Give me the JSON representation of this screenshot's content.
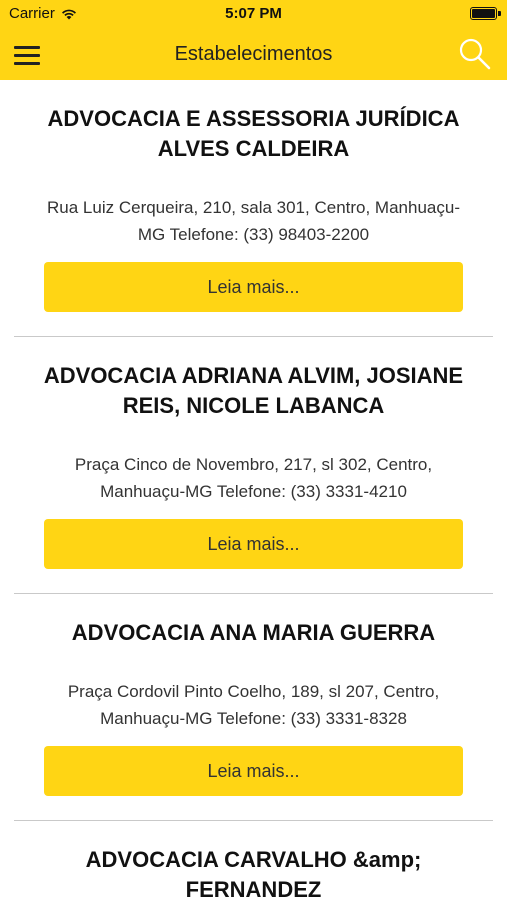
{
  "status_bar": {
    "carrier": "Carrier",
    "time": "5:07 PM"
  },
  "nav": {
    "title": "Estabelecimentos",
    "menu_icon": "hamburger-menu-icon",
    "search_icon": "search-icon"
  },
  "colors": {
    "accent": "#FFD514",
    "divider": "#c9c9c9"
  },
  "listings": [
    {
      "name": "ADVOCACIA E ASSESSORIA JURÍDICA ALVES CALDEIRA",
      "address": "Rua Luiz Cerqueira, 210, sala 301, Centro, Manhuaçu-MG Telefone: (33) 98403-2200",
      "button": "Leia mais..."
    },
    {
      "name": "ADVOCACIA ADRIANA ALVIM, JOSIANE REIS, NICOLE LABANCA",
      "address": "Praça Cinco de Novembro, 217, sl 302, Centro, Manhuaçu-MG Telefone: (33) 3331-4210",
      "button": "Leia mais..."
    },
    {
      "name": "ADVOCACIA ANA MARIA GUERRA",
      "address": "Praça Cordovil Pinto Coelho, 189, sl 207, Centro, Manhuaçu-MG Telefone: (33) 3331-8328",
      "button": "Leia mais..."
    },
    {
      "name": "ADVOCACIA CARVALHO &amp; FERNANDEZ",
      "address": "",
      "button": ""
    }
  ]
}
